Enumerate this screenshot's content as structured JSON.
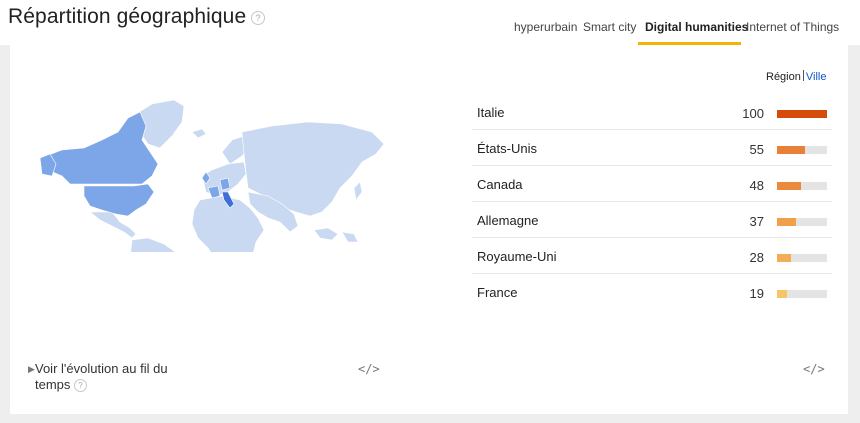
{
  "header": {
    "title": "Répartition géographique",
    "help_glyph": "?"
  },
  "tabs": [
    {
      "label": "hyperurbain",
      "active": false
    },
    {
      "label": "Smart city",
      "active": false
    },
    {
      "label": "Digital humanities",
      "active": true
    },
    {
      "label": "Internet of Things",
      "active": false
    }
  ],
  "view_toggle": {
    "region_label": "Région",
    "city_label": "Ville"
  },
  "ranking": [
    {
      "name": "Italie",
      "value": "100",
      "score": 100,
      "color": "#d44b0b"
    },
    {
      "name": "États-Unis",
      "value": "55",
      "score": 55,
      "color": "#e8803a"
    },
    {
      "name": "Canada",
      "value": "48",
      "score": 48,
      "color": "#ea8a3c"
    },
    {
      "name": "Allemagne",
      "value": "37",
      "score": 37,
      "color": "#f1a04a"
    },
    {
      "name": "Royaume-Uni",
      "value": "28",
      "score": 28,
      "color": "#f3ad52"
    },
    {
      "name": "France",
      "value": "19",
      "score": 19,
      "color": "#f7c466"
    }
  ],
  "evolution": {
    "label": "Voir l'évolution au fil du temps",
    "help_glyph": "?"
  },
  "embed_glyph": "</>",
  "colors": {
    "map_base": "#cad9f2",
    "map_medium": "#7da6e8",
    "map_strong": "#3d6fd6",
    "tab_underline": "#f4b400",
    "link": "#1155cc"
  },
  "icons": {
    "expand": "triangle-right-icon",
    "embed": "code-icon",
    "help": "help-icon"
  }
}
